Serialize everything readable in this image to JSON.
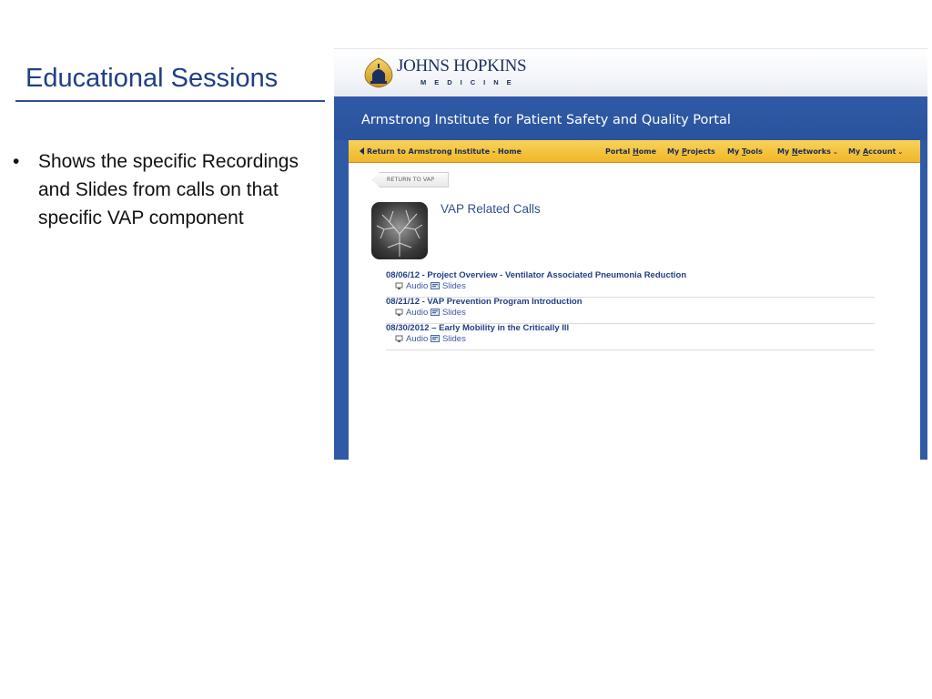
{
  "slide": {
    "title": "Educational Sessions",
    "bullet_symbol": "•",
    "bullet": "Shows the specific Recordings and Slides from calls on that specific VAP component"
  },
  "header": {
    "logo_main": "JOHNS HOPKINS",
    "logo_sub": "MEDICINE",
    "portal_title": "Armstrong Institute for Patient Safety and Quality Portal"
  },
  "nav": {
    "back_label": "Return to Armstrong Institute - Home",
    "items": [
      {
        "pre": "Portal ",
        "key": "H",
        "post": "ome",
        "chevron": ""
      },
      {
        "pre": "My ",
        "key": "P",
        "post": "rojects",
        "chevron": ""
      },
      {
        "pre": "My ",
        "key": "T",
        "post": "ools",
        "chevron": ""
      },
      {
        "pre": "My ",
        "key": "N",
        "post": "etworks",
        "chevron": "⌄"
      },
      {
        "pre": "My ",
        "key": "A",
        "post": "ccount",
        "chevron": "⌄"
      }
    ]
  },
  "page": {
    "return_button": "RETURN TO VAP",
    "heading": "VAP Related Calls"
  },
  "calls": [
    {
      "title": "08/06/12 - Project Overview - Ventilator Associated Pneumonia Reduction",
      "audio_label": "Audio",
      "slides_label": "Slides"
    },
    {
      "title": "08/21/12 - VAP Prevention Program Introduction",
      "audio_label": "Audio",
      "slides_label": "Slides"
    },
    {
      "title": "08/30/2012 – Early Mobility in the Critically Ill",
      "audio_label": "Audio",
      "slides_label": "Slides"
    }
  ],
  "icons": {
    "logo": "dome-shield-icon",
    "back": "left-arrow-icon",
    "audio": "speaker-icon",
    "slides": "slides-icon"
  },
  "colors": {
    "title_blue": "#1f3f86",
    "portal_blue": "#2f5aa5",
    "nav_gold": "#f0b729",
    "link_blue": "#3b5aa8"
  }
}
